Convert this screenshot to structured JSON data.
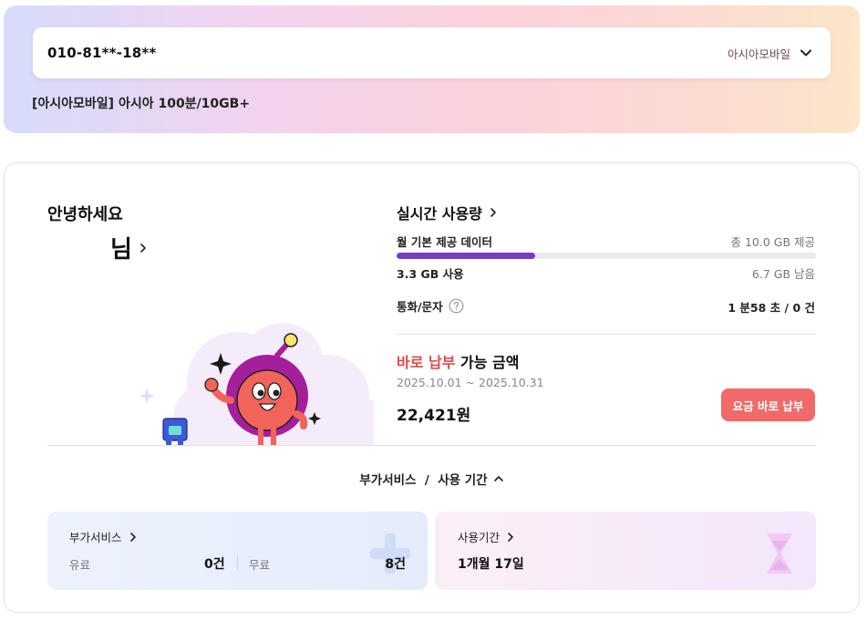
{
  "account": {
    "phone_number": "010-81**-18**",
    "carrier": "아시아모바일",
    "plan_name": "[아시아모바일] 아시아 100분/10GB+"
  },
  "greeting": {
    "hello": "안녕하세요",
    "name_suffix": "님"
  },
  "usage": {
    "title": "실시간 사용량",
    "data_label": "월 기본 제공 데이터",
    "data_total": "총 10.0 GB 제공",
    "data_used": "3.3 GB 사용",
    "data_remaining": "6.7 GB 남음",
    "data_used_fraction": 0.33,
    "call_label": "통화/문자",
    "call_value": "1 분58 초 / 0 건"
  },
  "payment": {
    "title_accent": "바로 납부",
    "title_rest": " 가능 금액",
    "period": "2025.10.01 ~ 2025.10.31",
    "amount": "22,421원",
    "button_label": "요금 바로 납부"
  },
  "services_toggle": {
    "label": "부가서비스  /  사용 기간"
  },
  "addon_box": {
    "title": "부가서비스",
    "paid_label": "유료",
    "paid_count": "0건",
    "free_label": "무료",
    "free_count": "8건"
  },
  "period_box": {
    "title": "사용기간",
    "value": "1개월 17일"
  },
  "colors": {
    "accent_red": "#e24a4a",
    "pay_button": "#f06a6a",
    "data_bar": "#7a3dbf"
  },
  "icons": {
    "carrier_dropdown": "chevron-down-icon",
    "name_link": "chevron-right-icon",
    "help": "question-circle-icon",
    "toggle": "chevron-up-icon"
  }
}
